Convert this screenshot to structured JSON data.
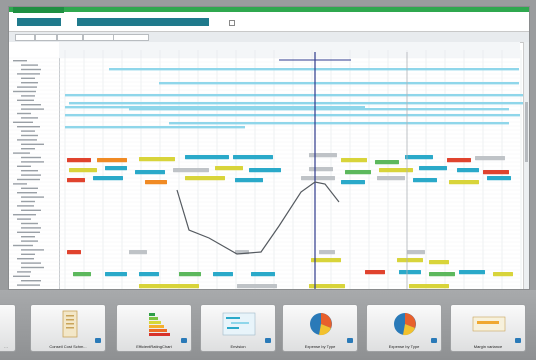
{
  "window": {
    "tab_label": "",
    "checkbox_label": ""
  },
  "filters": [
    {
      "label": ""
    },
    {
      "label": ""
    }
  ],
  "toolbar": {
    "buttons": [
      "",
      "",
      "",
      "",
      ""
    ]
  },
  "tray": {
    "tiles": [
      {
        "label": "Conseil Cost Schm...",
        "icon": "document-stack-icon"
      },
      {
        "label": "EfficientRatingChart",
        "icon": "energy-rating-chart-icon"
      },
      {
        "label": "Envision",
        "icon": "timeline-view-icon"
      },
      {
        "label": "Expense by Type",
        "icon": "pie-chart-icon"
      },
      {
        "label": "Expense by Type",
        "icon": "pie-chart-icon"
      },
      {
        "label": "Margin variance",
        "icon": "bar-chart-icon"
      }
    ]
  },
  "colors": {
    "accent_green": "#2fa84f",
    "filter_teal": "#1f7a8c",
    "bar_cyan": "#2aa9c9",
    "bar_light_cyan": "#8fd6ea",
    "bar_red": "#e0432e",
    "bar_orange": "#f08a24",
    "bar_yellow": "#d8d43a",
    "bar_green": "#5cb85c",
    "bar_gray": "#bfc3c7",
    "marker_navy": "#2e3a8c"
  }
}
